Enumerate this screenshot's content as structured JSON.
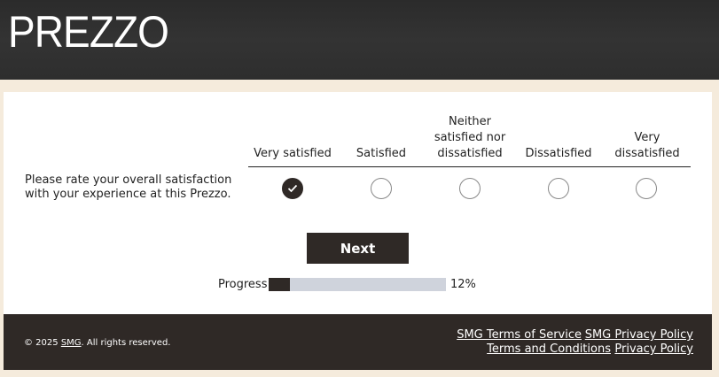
{
  "brand": {
    "logo_text": "PREZZO"
  },
  "survey": {
    "columns": [
      "Very satisfied",
      "Satisfied",
      "Neither satisfied nor dissatisfied",
      "Dissatisfied",
      "Very dissatisfied"
    ],
    "column_lines": [
      [
        "Very satisfied"
      ],
      [
        "Satisfied"
      ],
      [
        "Neither",
        "satisfied nor",
        "dissatisfied"
      ],
      [
        "Dissatisfied"
      ],
      [
        "Very",
        "dissatisfied"
      ]
    ],
    "question": "Please rate your overall satisfaction with your experience at this Prezzo.",
    "selected_index": 0
  },
  "nav": {
    "next_label": "Next"
  },
  "progress": {
    "label": "Progress",
    "value": 0.12,
    "percent_text": "12%"
  },
  "footer": {
    "copyright_prefix": "© 2025 ",
    "copyright_company": "SMG",
    "copyright_suffix": ". All rights reserved.",
    "links": {
      "terms_of_service": "SMG Terms of Service",
      "privacy_policy": "SMG Privacy Policy",
      "terms_conditions": "Terms and Conditions",
      "privacy": "Privacy Policy"
    }
  },
  "colors": {
    "dark": "#2f2926",
    "background": "#f5ebdc",
    "progress_track": "#cfd3dc"
  }
}
